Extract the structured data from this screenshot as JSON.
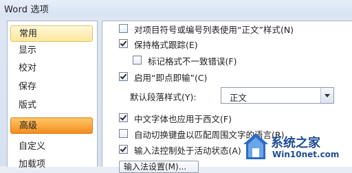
{
  "window": {
    "title": "Word 选项"
  },
  "sidebar": {
    "items": [
      {
        "label": "常用"
      },
      {
        "label": "显示"
      },
      {
        "label": "校对"
      },
      {
        "label": "保存"
      },
      {
        "label": "版式"
      },
      {
        "label": "高级"
      },
      {
        "label": "自定义"
      },
      {
        "label": "加载项"
      }
    ]
  },
  "options": [
    {
      "label": "对项目符号或编号列表使用“正文”样式(N)",
      "checked": false
    },
    {
      "label": "保持格式跟踪(E)",
      "checked": true
    },
    {
      "label": "标记格式不一致错误(F)",
      "checked": false
    },
    {
      "label": "启用“即点即输”(C)",
      "checked": true
    },
    {
      "label": "中文字体也应用于西文(F)",
      "checked": true
    },
    {
      "label": "自动切换键盘以匹配周围文字的语言(R)",
      "checked": false
    },
    {
      "label": "输入法控制处于活动状态(A)",
      "checked": true
    }
  ],
  "default_paragraph_style": {
    "label": "默认段落样式(Y):",
    "value": "正文"
  },
  "bottom_button": {
    "label": "输入法设置(M)..."
  },
  "watermark": {
    "line1": "系统之家",
    "line2": "Win10net.com"
  },
  "colors": {
    "selected_item": "#fde79a",
    "highlight_item": "#f38c1e",
    "watermark": "#1e4d96"
  }
}
